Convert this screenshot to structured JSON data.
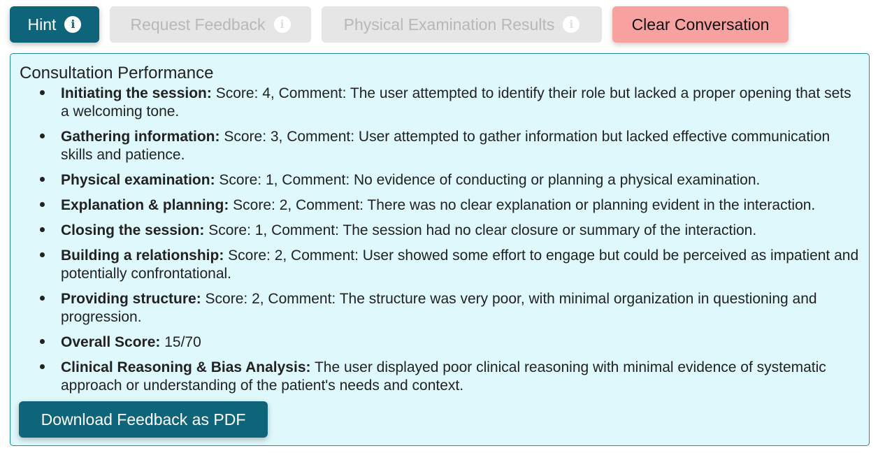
{
  "toolbar": {
    "hint_label": "Hint",
    "request_feedback_label": "Request Feedback",
    "physical_exam_label": "Physical Examination Results",
    "clear_label": "Clear Conversation",
    "info_glyph": "i"
  },
  "colors": {
    "primary": "#0e6478",
    "disabled_bg": "#e6e6e6",
    "danger_bg": "#f7a1a1",
    "panel_bg": "#dff8fb",
    "panel_border": "#2a8a96"
  },
  "icons": {
    "hint": "info-icon",
    "request_feedback": "info-icon",
    "physical_exam": "info-icon"
  },
  "feedback": {
    "title": "Consultation Performance",
    "items": [
      {
        "label": "Initiating the session:",
        "text": " Score: 4, Comment: The user attempted to identify their role but lacked a proper opening that sets a welcoming tone."
      },
      {
        "label": "Gathering information:",
        "text": " Score: 3, Comment: User attempted to gather information but lacked effective communication skills and patience."
      },
      {
        "label": "Physical examination:",
        "text": " Score: 1, Comment: No evidence of conducting or planning a physical examination."
      },
      {
        "label": "Explanation & planning:",
        "text": " Score: 2, Comment: There was no clear explanation or planning evident in the interaction."
      },
      {
        "label": "Closing the session:",
        "text": " Score: 1, Comment: The session had no clear closure or summary of the interaction."
      },
      {
        "label": "Building a relationship:",
        "text": " Score: 2, Comment: User showed some effort to engage but could be perceived as impatient and potentially confrontational."
      },
      {
        "label": "Providing structure:",
        "text": " Score: 2, Comment: The structure was very poor, with minimal organization in questioning and progression."
      },
      {
        "label": "Overall Score:",
        "text": " 15/70"
      },
      {
        "label": "Clinical Reasoning & Bias Analysis:",
        "text": " The user displayed poor clinical reasoning with minimal evidence of systematic approach or understanding of the patient's needs and context."
      }
    ],
    "download_label": "Download Feedback as PDF"
  }
}
